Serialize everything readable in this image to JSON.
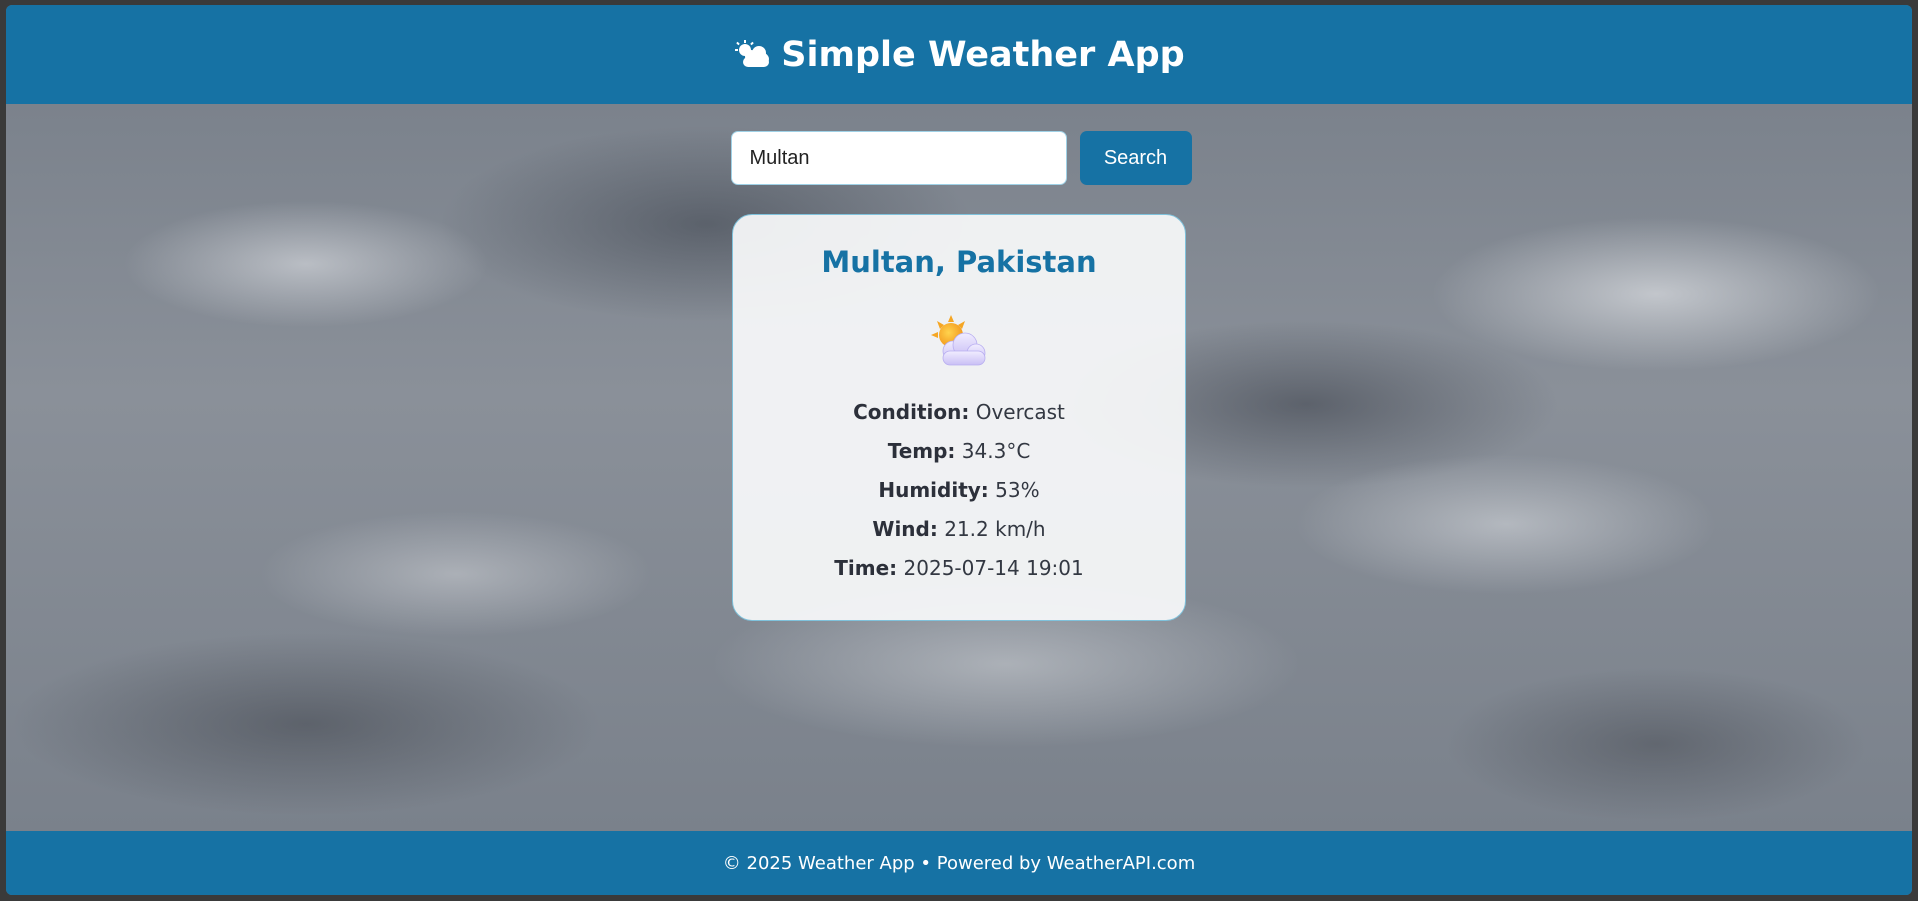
{
  "header": {
    "title": "Simple Weather App",
    "icon": "sun-behind-cloud-icon"
  },
  "search": {
    "value": "Multan",
    "button_label": "Search"
  },
  "card": {
    "location": "Multan, Pakistan",
    "icon": "sun-behind-cloud-icon",
    "details": [
      {
        "label": "Condition:",
        "value": "Overcast"
      },
      {
        "label": "Temp:",
        "value": "34.3°C"
      },
      {
        "label": "Humidity:",
        "value": "53%"
      },
      {
        "label": "Wind:",
        "value": "21.2 km/h"
      },
      {
        "label": "Time:",
        "value": "2025-07-14 19:01"
      }
    ]
  },
  "footer": {
    "text": "© 2025 Weather App • Powered by WeatherAPI.com"
  },
  "colors": {
    "brand": "#1672a4",
    "card_background": "#f8f9fa"
  }
}
